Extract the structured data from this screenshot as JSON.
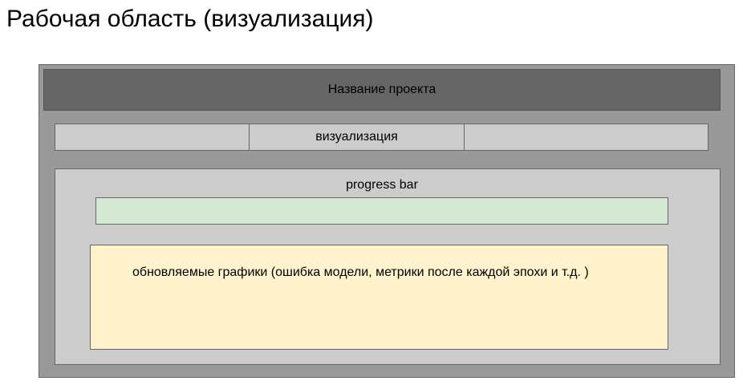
{
  "page_title": "Рабочая область (визуализация)",
  "header": {
    "title": "Название проекта"
  },
  "tabs": [
    {
      "label": ""
    },
    {
      "label": "визуализация"
    },
    {
      "label": ""
    }
  ],
  "workspace": {
    "progress_label": "progress bar",
    "charts_text": "обновляемые графики (ошибка модели, метрики после каждой эпохи и т.д. )"
  },
  "colors": {
    "outer_frame": "#999999",
    "header_bar": "#666666",
    "tabs": "#cccccc",
    "progress_bar": "#d5e8d4",
    "charts_box": "#fff2cc"
  }
}
